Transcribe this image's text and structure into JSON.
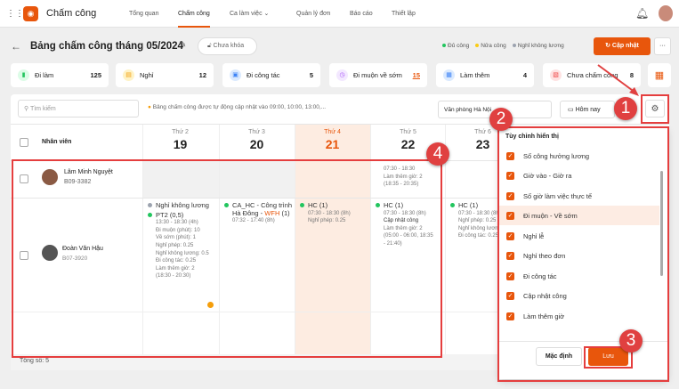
{
  "app": {
    "title": "Chấm công"
  },
  "nav": [
    {
      "label": "Tổng quan"
    },
    {
      "label": "Chấm công",
      "active": true
    },
    {
      "label": "Ca làm việc"
    },
    {
      "label": "Quản lý đơn"
    },
    {
      "label": "Báo cáo"
    },
    {
      "label": "Thiết lập"
    }
  ],
  "header": {
    "title": "Bảng chấm công tháng 05/2024",
    "lock_label": "Chưa khóa",
    "legend": [
      {
        "label": "Đủ công",
        "color": "#22c55e"
      },
      {
        "label": "Nửa công",
        "color": "#facc15"
      },
      {
        "label": "Nghỉ không lương",
        "color": "#9ca3af"
      }
    ],
    "update_label": "Cập nhật",
    "more_label": "···"
  },
  "stats": [
    {
      "label": "Đi làm",
      "value": "125",
      "color": "#22c55e"
    },
    {
      "label": "Nghỉ",
      "value": "12",
      "color": "#f59e0b"
    },
    {
      "label": "Đi công tác",
      "value": "5",
      "color": "#3b82f6"
    },
    {
      "label": "Đi muộn về sớm",
      "value": "15",
      "color": "#a855f7"
    },
    {
      "label": "Làm thêm",
      "value": "4",
      "color": "#3b82f6"
    },
    {
      "label": "Chưa chấm công",
      "value": "8",
      "color": "#ef4444"
    }
  ],
  "toolbar": {
    "search_placeholder": "Tìm kiếm",
    "info": "Bảng chấm công được tự động cập nhật vào 09:00, 10:00, 13:00,...",
    "office": "Văn phòng Hà Nội",
    "today_label": "Hôm nay"
  },
  "table": {
    "employee_header": "Nhân viên",
    "days": [
      {
        "dow": "Thứ 2",
        "date": "19"
      },
      {
        "dow": "Thứ 3",
        "date": "20"
      },
      {
        "dow": "Thứ 4",
        "date": "21",
        "today": true
      },
      {
        "dow": "Thứ 5",
        "date": "22"
      },
      {
        "dow": "Thứ 6",
        "date": "23"
      }
    ],
    "employees": [
      {
        "name": "Lâm Minh Nguyệt",
        "code": "B09-3382",
        "d22": [
          "07:30 - 18:30",
          "Làm thêm giờ: 2",
          "(18:35 - 20:35)"
        ]
      },
      {
        "name": "Đoàn Văn Hậu",
        "code": "B07-3920",
        "d19": {
          "a": "Nghỉ không lương",
          "b": "PT2 (0,5)",
          "lines": [
            "13:30 - 18:30 (4h)",
            "Đi muộn (phút): 10",
            "Về sớm (phút): 1",
            "Nghỉ phép: 0.25",
            "Nghỉ không lương: 0.5",
            "Đi công tác: 0.25",
            "Làm thêm giờ: 2",
            "(18:30 - 20:30)"
          ]
        },
        "d20": {
          "a": "CA_HC - Công trình Hà Đông - ",
          "wfh": "WFH",
          "a2": " (1)",
          "lines": [
            "07:32 - 17:40 (8h)"
          ]
        },
        "d21": {
          "a": "HC (1)",
          "lines": [
            "07:30 - 18:30 (8h)",
            "Nghỉ phép: 0.25"
          ]
        },
        "d22": {
          "a": "HC (1)",
          "lines": [
            "07:30 - 18:30 (8h)"
          ],
          "bold": "Cập nhật công",
          "lines2": [
            "Làm thêm giờ: 2",
            "(05:00 - 06:00, 18:35",
            "- 21:40)"
          ]
        },
        "d23": {
          "a": "HC (1)",
          "lines": [
            "07:30 - 18:30 (8h)",
            "Nghỉ phép: 0.25",
            "Nghỉ không lương",
            "Đi công tác: 0.25"
          ]
        }
      }
    ],
    "total": "Tổng số: 5"
  },
  "display_menu": {
    "title": "Tùy chỉnh hiển thị",
    "options": [
      "Số công hưởng lương",
      "Giờ vào - Giờ ra",
      "Số giờ làm việc thực tế",
      "Đi muộn - Về sớm",
      "Nghỉ lễ",
      "Nghỉ theo đơn",
      "Đi công tác",
      "Cập nhật công",
      "Làm thêm giờ"
    ],
    "default_label": "Mặc định",
    "save_label": "Lưu"
  },
  "annotations": [
    "1",
    "2",
    "3",
    "4"
  ]
}
